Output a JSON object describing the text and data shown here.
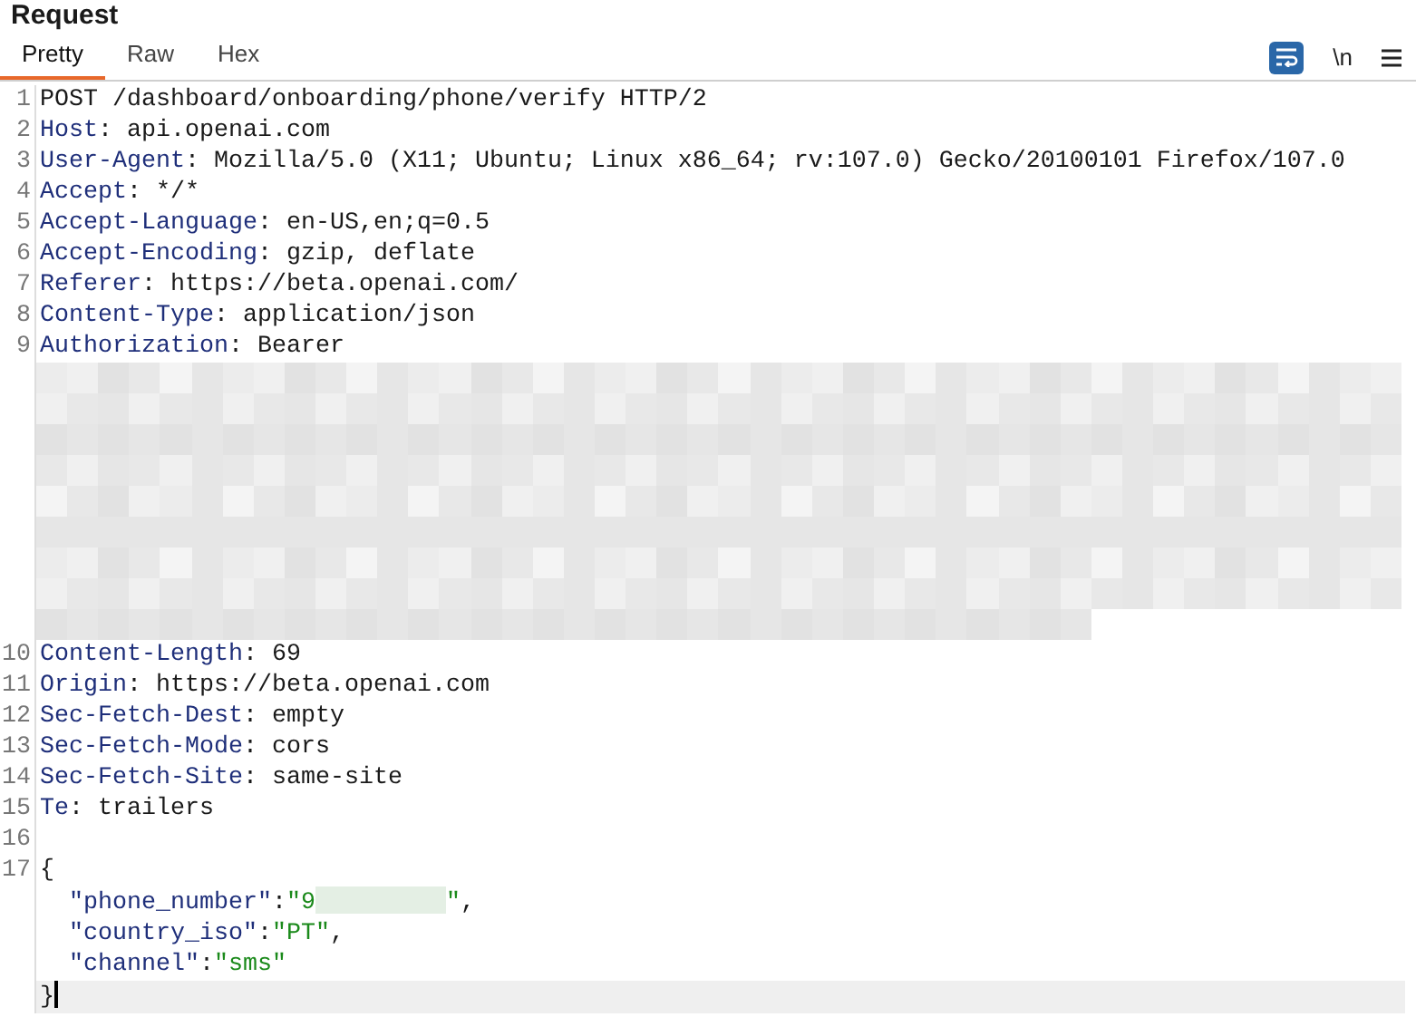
{
  "panel": {
    "title": "Request"
  },
  "tabs": [
    {
      "label": "Pretty",
      "selected": true
    },
    {
      "label": "Raw",
      "selected": false
    },
    {
      "label": "Hex",
      "selected": false
    }
  ],
  "toolbar": [
    {
      "kind": "wrap",
      "on": true
    },
    {
      "kind": "text",
      "label": "\\n"
    },
    {
      "kind": "menu"
    }
  ],
  "lines": [
    {
      "number": "1",
      "kind": "code",
      "current": false,
      "segments": [
        {
          "kind": "plain",
          "text": "POST /dashboard/onboarding/phone/verify HTTP/2"
        }
      ]
    },
    {
      "number": "2",
      "kind": "code",
      "current": false,
      "segments": [
        {
          "kind": "name",
          "text": "Host"
        },
        {
          "kind": "plain",
          "text": ": api.openai.com"
        }
      ]
    },
    {
      "number": "3",
      "kind": "code",
      "current": false,
      "segments": [
        {
          "kind": "name",
          "text": "User-Agent"
        },
        {
          "kind": "plain",
          "text": ": Mozilla/5.0 (X11; Ubuntu; Linux x86_64; rv:107.0) Gecko/20100101 Firefox/107.0"
        }
      ]
    },
    {
      "number": "4",
      "kind": "code",
      "current": false,
      "segments": [
        {
          "kind": "name",
          "text": "Accept"
        },
        {
          "kind": "plain",
          "text": ": */*"
        }
      ]
    },
    {
      "number": "5",
      "kind": "code",
      "current": false,
      "segments": [
        {
          "kind": "name",
          "text": "Accept-Language"
        },
        {
          "kind": "plain",
          "text": ": en-US,en;q=0.5"
        }
      ]
    },
    {
      "number": "6",
      "kind": "code",
      "current": false,
      "segments": [
        {
          "kind": "name",
          "text": "Accept-Encoding"
        },
        {
          "kind": "plain",
          "text": ": gzip, deflate"
        }
      ]
    },
    {
      "number": "7",
      "kind": "code",
      "current": false,
      "segments": [
        {
          "kind": "name",
          "text": "Referer"
        },
        {
          "kind": "plain",
          "text": ": https://beta.openai.com/"
        }
      ]
    },
    {
      "number": "8",
      "kind": "code",
      "current": false,
      "segments": [
        {
          "kind": "name",
          "text": "Content-Type"
        },
        {
          "kind": "plain",
          "text": ": application/json"
        }
      ]
    },
    {
      "number": "9",
      "kind": "code",
      "current": false,
      "segments": [
        {
          "kind": "name",
          "text": "Authorization"
        },
        {
          "kind": "plain",
          "text": ": Bearer"
        }
      ]
    },
    {
      "kind": "redacted"
    },
    {
      "number": "10",
      "kind": "code",
      "current": false,
      "segments": [
        {
          "kind": "name",
          "text": "Content-Length"
        },
        {
          "kind": "plain",
          "text": ": 69"
        }
      ]
    },
    {
      "number": "11",
      "kind": "code",
      "current": false,
      "segments": [
        {
          "kind": "name",
          "text": "Origin"
        },
        {
          "kind": "plain",
          "text": ": https://beta.openai.com"
        }
      ]
    },
    {
      "number": "12",
      "kind": "code",
      "current": false,
      "segments": [
        {
          "kind": "name",
          "text": "Sec-Fetch-Dest"
        },
        {
          "kind": "plain",
          "text": ": empty"
        }
      ]
    },
    {
      "number": "13",
      "kind": "code",
      "current": false,
      "segments": [
        {
          "kind": "name",
          "text": "Sec-Fetch-Mode"
        },
        {
          "kind": "plain",
          "text": ": cors"
        }
      ]
    },
    {
      "number": "14",
      "kind": "code",
      "current": false,
      "segments": [
        {
          "kind": "name",
          "text": "Sec-Fetch-Site"
        },
        {
          "kind": "plain",
          "text": ": same-site"
        }
      ]
    },
    {
      "number": "15",
      "kind": "code",
      "current": false,
      "segments": [
        {
          "kind": "name",
          "text": "Te"
        },
        {
          "kind": "plain",
          "text": ": trailers"
        }
      ]
    },
    {
      "number": "16",
      "kind": "code",
      "current": false
    },
    {
      "number": "17",
      "kind": "code",
      "current": false,
      "segments": [
        {
          "kind": "plain",
          "text": "{"
        }
      ]
    },
    {
      "kind": "code",
      "current": false,
      "indent": true,
      "segments": [
        {
          "kind": "name",
          "text": "\"phone_number\""
        },
        {
          "kind": "plain",
          "text": ":"
        },
        {
          "kind": "string",
          "text": "\"9"
        },
        {
          "kind": "redacted"
        },
        {
          "kind": "string",
          "text": "\""
        },
        {
          "kind": "plain",
          "text": ","
        }
      ]
    },
    {
      "kind": "code",
      "current": false,
      "indent": true,
      "segments": [
        {
          "kind": "name",
          "text": "\"country_iso\""
        },
        {
          "kind": "plain",
          "text": ":"
        },
        {
          "kind": "string",
          "text": "\"PT\""
        },
        {
          "kind": "plain",
          "text": ","
        }
      ]
    },
    {
      "kind": "code",
      "current": false,
      "indent": true,
      "segments": [
        {
          "kind": "name",
          "text": "\"channel\""
        },
        {
          "kind": "plain",
          "text": ":"
        },
        {
          "kind": "string",
          "text": "\"sms\""
        }
      ]
    },
    {
      "kind": "code",
      "current": true,
      "segments": [
        {
          "kind": "plain",
          "text": "}"
        }
      ]
    }
  ]
}
